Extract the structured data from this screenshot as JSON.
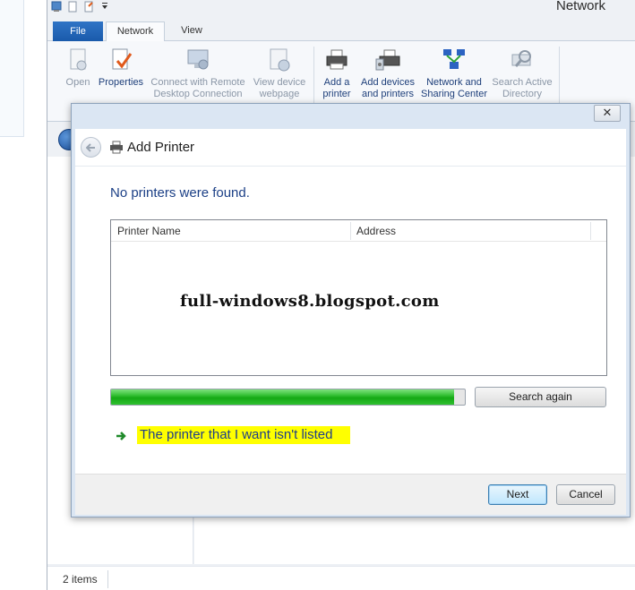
{
  "window": {
    "title": "Network"
  },
  "ribbon": {
    "tabs": [
      {
        "label": "File"
      },
      {
        "label": "Network"
      },
      {
        "label": "View"
      }
    ],
    "buttons": {
      "open": "Open",
      "properties": "Properties",
      "connect_remote_1": "Connect with Remote",
      "connect_remote_2": "Desktop Connection",
      "view_device_1": "View device",
      "view_device_2": "webpage",
      "add_printer_1": "Add a",
      "add_printer_2": "printer",
      "add_devices_1": "Add devices",
      "add_devices_2": "and printers",
      "network_sharing_1": "Network and",
      "network_sharing_2": "Sharing Center",
      "search_ad_1": "Search Active",
      "search_ad_2": "Directory"
    }
  },
  "dialog": {
    "title": "Add Printer",
    "headline": "No printers were found.",
    "columns": [
      "Printer Name",
      "Address"
    ],
    "watermark": "full-windows8.blogspot.com",
    "progress_fraction": 0.97,
    "search_again_label": "Search again",
    "not_listed_link": "The printer that I want isn't listed",
    "next_label": "Next",
    "cancel_label": "Cancel",
    "close_glyph": "✕"
  },
  "status": {
    "items_count": "2 items"
  },
  "colors": {
    "accent": "#1b3f86",
    "highlight": "#ffff00",
    "progress": "#15a915",
    "file_tab": "#1a5aab"
  }
}
